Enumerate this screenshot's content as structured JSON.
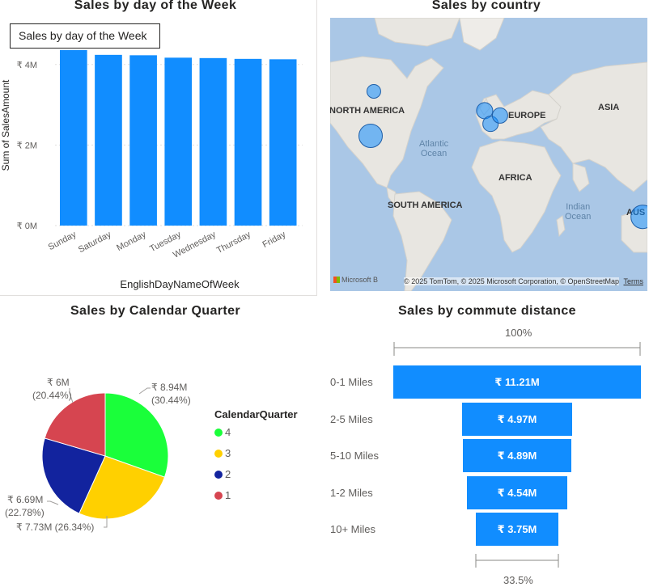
{
  "bar_visual": {
    "title": "Sales by day of the Week",
    "tooltip": "Sales by day of the Week"
  },
  "map_visual": {
    "title": "Sales by country",
    "labels": {
      "north_america": "NORTH AMERICA",
      "europe": "EUROPE",
      "asia": "ASIA",
      "africa": "AFRICA",
      "south_america": "SOUTH AMERICA",
      "australia": "AUS"
    },
    "oceans": {
      "atlantic": "Atlantic\nOcean",
      "indian": "Indian\nOcean"
    },
    "ms_logo": "Microsoft B",
    "attribution": "© 2025 TomTom, © 2025 Microsoft Corporation, © OpenStreetMap",
    "terms": "Terms"
  },
  "pie_visual": {
    "title": "Sales by Calendar Quarter",
    "legend_title": "CalendarQuarter"
  },
  "funnel_visual": {
    "title": "Sales by commute distance",
    "top_pct": "100%",
    "bottom_pct": "33.5%"
  },
  "chart_data": [
    {
      "type": "bar",
      "title": "Sales by day of the Week",
      "xlabel": "EnglishDayNameOfWeek",
      "ylabel": "Sum of SalesAmount",
      "categories": [
        "Sunday",
        "Saturday",
        "Monday",
        "Tuesday",
        "Wednesday",
        "Thursday",
        "Friday"
      ],
      "values": [
        4.36,
        4.24,
        4.23,
        4.17,
        4.16,
        4.14,
        4.13
      ],
      "ylim": [
        0,
        5
      ],
      "yticks": [
        0,
        2,
        4
      ],
      "ytick_labels": [
        "₹ 0M",
        "₹ 2M",
        "₹ 4M"
      ],
      "grid": true,
      "color": "#118dff"
    },
    {
      "type": "pie",
      "title": "Sales by Calendar Quarter",
      "legend_title": "CalendarQuarter",
      "slices": [
        {
          "name": "4",
          "value": 8.94,
          "percent": 30.44,
          "label": "₹ 8.94M",
          "pct_label": "(30.44%)",
          "color": "#1aff3a"
        },
        {
          "name": "3",
          "value": 7.73,
          "percent": 26.34,
          "label": "₹ 7.73M (26.34%)",
          "color": "#ffd000"
        },
        {
          "name": "2",
          "value": 6.69,
          "percent": 22.78,
          "label": "₹ 6.69M",
          "pct_label": "(22.78%)",
          "color": "#12239e"
        },
        {
          "name": "1",
          "value": 6.0,
          "percent": 20.44,
          "label": "₹ 6M",
          "pct_label": "(20.44%)",
          "color": "#d64550"
        }
      ],
      "legend_placement": "right"
    },
    {
      "type": "bar",
      "subtype": "funnel",
      "title": "Sales by commute distance",
      "categories": [
        "0-1 Miles",
        "2-5 Miles",
        "5-10 Miles",
        "1-2 Miles",
        "10+ Miles"
      ],
      "values": [
        11.21,
        4.97,
        4.89,
        4.54,
        3.75
      ],
      "value_labels": [
        "₹ 11.21M",
        "₹ 4.97M",
        "₹ 4.89M",
        "₹ 4.54M",
        "₹ 3.75M"
      ],
      "top_percent": "100%",
      "bottom_percent": "33.5%",
      "color": "#118dff"
    }
  ],
  "map_bubbles": [
    {
      "name": "Canada",
      "value": 1.98
    },
    {
      "name": "United States",
      "value": 9.39
    },
    {
      "name": "United Kingdom",
      "value": 3.39
    },
    {
      "name": "France",
      "value": 2.64
    },
    {
      "name": "Germany",
      "value": 2.89
    },
    {
      "name": "Australia",
      "value": 9.06
    }
  ]
}
